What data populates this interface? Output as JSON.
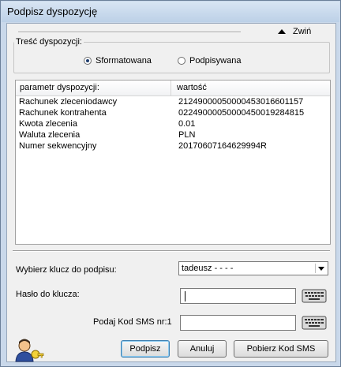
{
  "window": {
    "title": "Podpisz dyspozycję"
  },
  "header": {
    "collapse_label": "Zwiń"
  },
  "content_group": {
    "legend": "Treść dyspozycji:",
    "options": [
      {
        "label": "Sformatowana",
        "selected": true
      },
      {
        "label": "Podpisywana",
        "selected": false
      }
    ]
  },
  "table": {
    "columns": [
      "parametr dyspozycji:",
      "wartość"
    ],
    "rows": [
      {
        "param": "Rachunek zleceniodawcy",
        "value": "21249000050000453016601157"
      },
      {
        "param": "Rachunek kontrahenta",
        "value": "02249000050000450019284815"
      },
      {
        "param": "Kwota zlecenia",
        "value": "0.01"
      },
      {
        "param": "Waluta zlecenia",
        "value": "PLN"
      },
      {
        "param": "Numer sekwencyjny",
        "value": "20170607164629994R"
      }
    ]
  },
  "form": {
    "key_label": "Wybierz klucz do podpisu:",
    "key_value": "tadeusz - - - -",
    "password_label": "Hasło do klucza:",
    "password_value": "",
    "sms_label": "Podaj Kod SMS nr:1",
    "sms_value": ""
  },
  "buttons": {
    "sign": "Podpisz",
    "cancel": "Anuluj",
    "get_sms": "Pobierz Kod SMS"
  },
  "icons": {
    "keyboard": "keyboard-icon",
    "logo": "user-key-icon",
    "collapse": "triangle-up-icon"
  }
}
